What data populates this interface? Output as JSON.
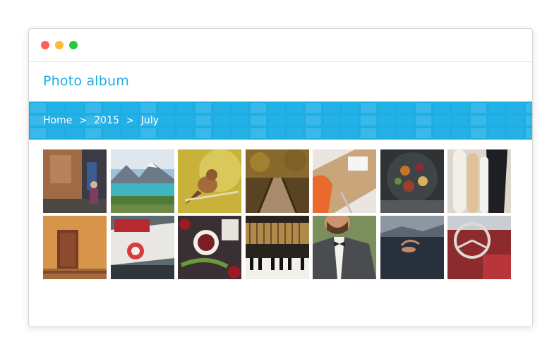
{
  "window": {
    "controls": [
      {
        "name": "close",
        "color": "#ff5f57"
      },
      {
        "name": "minimize",
        "color": "#febc2e"
      },
      {
        "name": "maximize",
        "color": "#28c840"
      }
    ]
  },
  "app": {
    "title": "Photo album",
    "accent_color": "#1eaee3"
  },
  "breadcrumb": {
    "items": [
      "Home",
      "2015",
      "July"
    ],
    "separator": ">"
  },
  "gallery": {
    "photos": [
      {
        "subject": "old-street-wall",
        "alt": "Street with old wall"
      },
      {
        "subject": "mountain-lake",
        "alt": "Mountain lake"
      },
      {
        "subject": "bird-on-branch",
        "alt": "Bird on a branch"
      },
      {
        "subject": "autumn-boardwalk",
        "alt": "Autumn boardwalk"
      },
      {
        "subject": "desk-orange-chair",
        "alt": "Desk with orange chair"
      },
      {
        "subject": "food-platter",
        "alt": "Food platter"
      },
      {
        "subject": "surfboards-wetsuit",
        "alt": "Surfboards and wetsuit"
      },
      {
        "subject": "orange-door",
        "alt": "Orange building door"
      },
      {
        "subject": "vintage-car-rear",
        "alt": "Vintage car rear"
      },
      {
        "subject": "tea-and-flowers",
        "alt": "Tea cup and flowers"
      },
      {
        "subject": "piano-interior",
        "alt": "Piano interior"
      },
      {
        "subject": "man-bowtie",
        "alt": "Man in suit with bow tie"
      },
      {
        "subject": "swimmer-lake",
        "alt": "Swimmer in lake"
      },
      {
        "subject": "car-steering-wheel",
        "alt": "Car steering wheel"
      }
    ]
  }
}
